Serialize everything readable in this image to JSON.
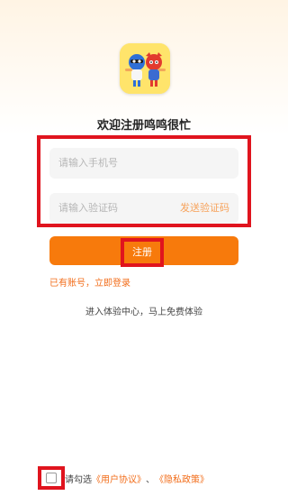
{
  "app": {
    "title": "欢迎注册鸣鸣很忙"
  },
  "form": {
    "phone_placeholder": "请输入手机号",
    "code_placeholder": "请输入验证码",
    "send_code_label": "发送验证码"
  },
  "register": {
    "label": "注册"
  },
  "login_link": "已有账号，立即登录",
  "trial_link": "进入体验中心，马上免费体验",
  "agreement": {
    "prefix": "请勾选",
    "user_agreement": "《用户协议》",
    "separator": "、",
    "privacy_policy": "《隐私政策》"
  },
  "colors": {
    "accent": "#f77a0c",
    "highlight": "#e0141e",
    "link": "#f26d1a"
  }
}
